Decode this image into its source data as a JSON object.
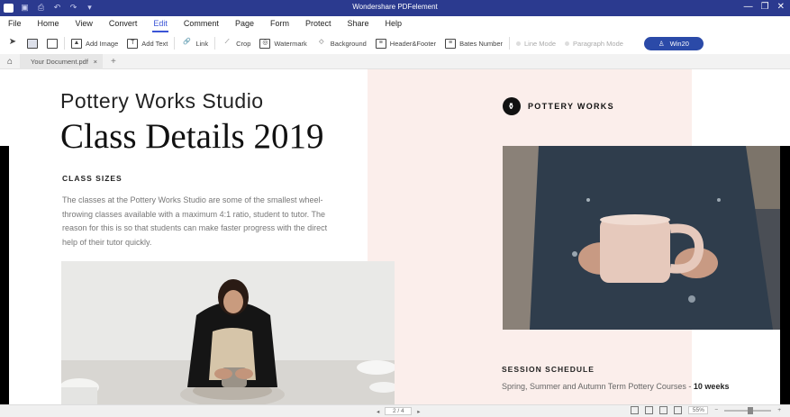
{
  "window": {
    "title": "Wondershare PDFelement",
    "controls": [
      "—",
      "❐",
      "✕"
    ]
  },
  "menu": {
    "items": [
      "File",
      "Home",
      "View",
      "Convert",
      "Edit",
      "Comment",
      "Page",
      "Form",
      "Protect",
      "Share",
      "Help"
    ],
    "active": "Edit"
  },
  "toolbar": {
    "add_image": "Add Image",
    "add_text": "Add Text",
    "link": "Link",
    "crop": "Crop",
    "watermark": "Watermark",
    "background": "Background",
    "header_footer": "Header&Footer",
    "bates_number": "Bates Number",
    "line_mode": "Line Mode",
    "paragraph_mode": "Paragraph Mode",
    "user": "Win20"
  },
  "tabs": {
    "document": "Your Document.pdf",
    "close": "×",
    "add": "+"
  },
  "document": {
    "heading_light": "Pottery Works Studio",
    "heading_serif": "Class Details 2019",
    "class_sizes_title": "CLASS SIZES",
    "class_sizes_body": "The classes at the Pottery Works Studio are some of the smallest wheel-throwing classes available with a maximum 4:1 ratio, student to tutor. The reason for this is so that students can make faster progress with the direct help of their tutor quickly.",
    "brand": "POTTERY WORKS",
    "schedule_title": "SESSION SCHEDULE",
    "schedule_text": "Spring, Summer and Autumn Term Pottery Courses - ",
    "schedule_bold": "10 weeks"
  },
  "status": {
    "page": "2 / 4",
    "zoom": "55%"
  },
  "colors": {
    "titlebar": "#2b3a8f",
    "accent": "#3b55d6",
    "pink_panel": "#fbeeeb"
  }
}
